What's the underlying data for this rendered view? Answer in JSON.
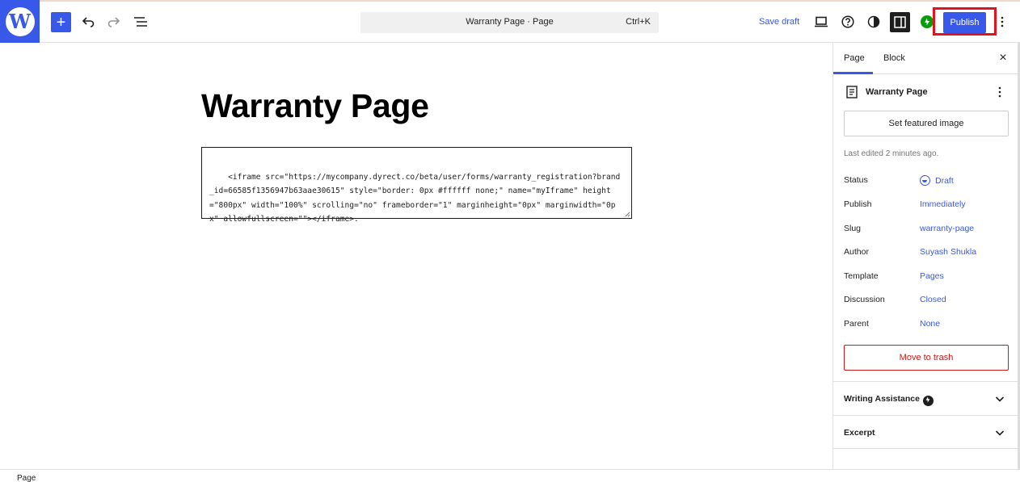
{
  "toolbar": {
    "logo_glyph": "W",
    "add_glyph": "+",
    "command_title": "Warranty Page · Page",
    "command_shortcut": "Ctrl+K",
    "save_draft_label": "Save draft",
    "publish_label": "Publish"
  },
  "editor": {
    "title": "Warranty Page",
    "code": "<iframe src=\"https://mycompany.dyrect.co/beta/user/forms/warranty_registration?brand_id=66585f1356947b63aae30615\" style=\"border: 0px #ffffff none;\" name=\"myIframe\" height=\"800px\" width=\"100%\" scrolling=\"no\" frameborder=\"1\" marginheight=\"0px\" marginwidth=\"0px\" allowfullscreen=\"\"></iframe>."
  },
  "sidebar": {
    "tabs": [
      {
        "label": "Page"
      },
      {
        "label": "Block"
      }
    ],
    "close_glyph": "×",
    "document_title": "Warranty Page",
    "featured_image_label": "Set featured image",
    "last_edited": "Last edited 2 minutes ago.",
    "meta": [
      {
        "label": "Status",
        "value": "Draft"
      },
      {
        "label": "Publish",
        "value": "Immediately"
      },
      {
        "label": "Slug",
        "value": "warranty-page"
      },
      {
        "label": "Author",
        "value": "Suyash Shukla"
      },
      {
        "label": "Template",
        "value": "Pages"
      },
      {
        "label": "Discussion",
        "value": "Closed"
      },
      {
        "label": "Parent",
        "value": "None"
      }
    ],
    "trash_label": "Move to trash",
    "panels": [
      {
        "title": "Writing Assistance"
      },
      {
        "title": "Excerpt"
      }
    ]
  },
  "statusbar": {
    "label": "Page"
  },
  "colors": {
    "accent": "#3858e9",
    "danger": "#cc1818",
    "highlight": "#e0141e",
    "jetpack": "#069e08"
  }
}
